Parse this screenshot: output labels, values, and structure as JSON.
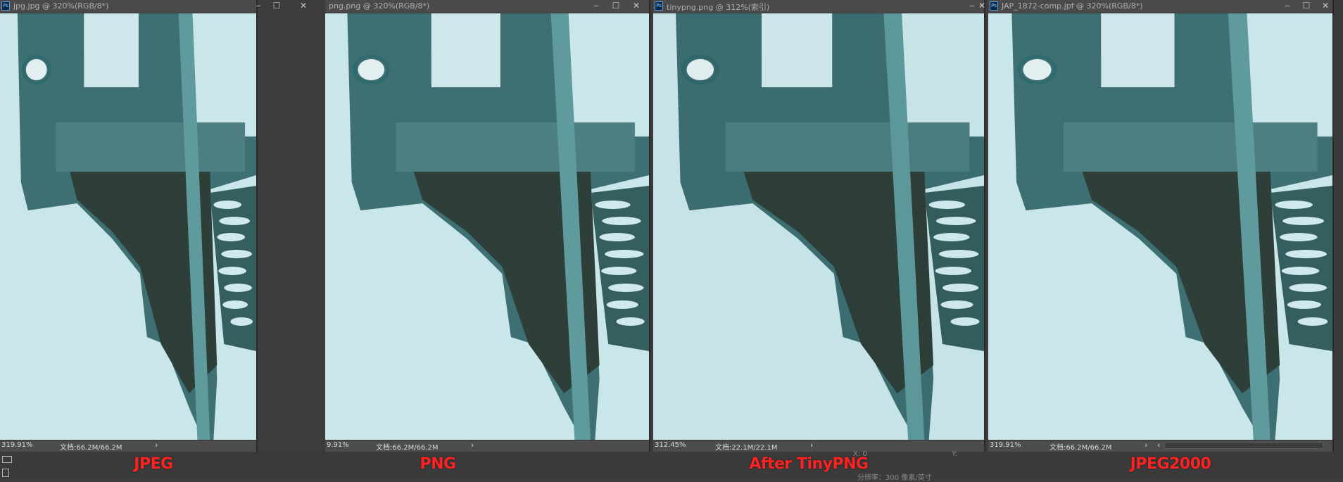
{
  "panels": [
    {
      "title": "jpg.jpg @ 320%(RGB/8*)",
      "zoom": "319.91%",
      "doc_size": "文档:66.2M/66.2M",
      "caption": "JPEG",
      "close": "✕"
    },
    {
      "title": "png.png @ 320%(RGB/8*)",
      "zoom": "9.91%",
      "doc_size": "文档:66.2M/66.2M",
      "caption": "PNG",
      "close": "✕"
    },
    {
      "title": "tinypng.png @ 312%(索引)",
      "zoom": "312.45%",
      "doc_size": "文档:22.1M/22.1M",
      "caption": "After TinyPNG",
      "close": "✕"
    },
    {
      "title": "JAP_1872-comp.jpf @ 320%(RGB/8*)",
      "zoom": "319.91%",
      "doc_size": "文档:66.2M/66.2M",
      "caption": "JPEG2000",
      "close": "✕"
    }
  ],
  "window_buttons": {
    "minimize": "‒",
    "maximize": "☐"
  },
  "statusbar_arrow": "›",
  "scroll_left_arrow": "‹",
  "info_panel": {
    "line1_left": "X: 0",
    "line1_right": "Y:",
    "line2": "分辨率：300 像素/英寸"
  },
  "colors": {
    "sky": "#c9e6ea",
    "structure": "#3d6f73",
    "dark": "#2e3f3a",
    "caption": "#ff2222"
  }
}
